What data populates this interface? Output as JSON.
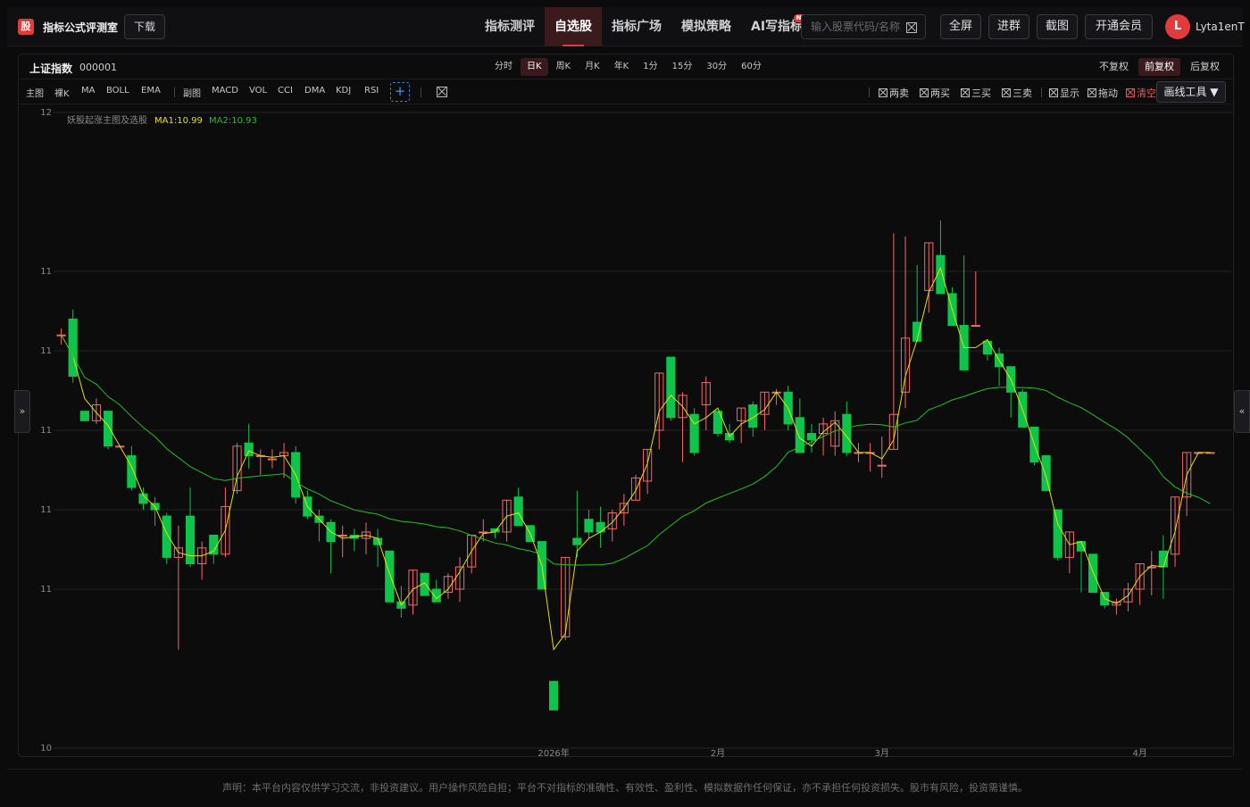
{
  "header": {
    "logo_char": "股",
    "brand": "指标公式评测室",
    "download": "下载",
    "nav": [
      {
        "label": "指标测评",
        "active": false
      },
      {
        "label": "自选股",
        "active": true
      },
      {
        "label": "指标广场",
        "active": false
      },
      {
        "label": "模拟策略",
        "active": false
      },
      {
        "label": "AI写指标",
        "active": false,
        "badge": "NEW"
      }
    ],
    "search_placeholder": "输入股票代码/名称",
    "buttons": {
      "fullscreen": "全屏",
      "join_group": "进群",
      "screenshot": "截图",
      "membership": "开通会员"
    },
    "user": {
      "avatar_letter": "L",
      "name": "Lyta1enT"
    }
  },
  "stock": {
    "name": "上证指数",
    "code": "000001"
  },
  "periods": [
    "分时",
    "日K",
    "周K",
    "月K",
    "年K",
    "1分",
    "15分",
    "30分",
    "60分"
  ],
  "active_period": "日K",
  "adjust": [
    "不复权",
    "前复权",
    "后复权"
  ],
  "active_adjust": "前复权",
  "indicators": {
    "main_label": "主图",
    "main": [
      "裸K",
      "MA",
      "BOLL",
      "EMA"
    ],
    "sub_label": "副图",
    "sub": [
      "MACD",
      "VOL",
      "CCI",
      "DMA",
      "KDJ",
      "RSI"
    ]
  },
  "tools": [
    "两卖",
    "两买",
    "三买",
    "三卖",
    "显示",
    "拖动",
    "清空"
  ],
  "draw_tools": "画线工具 ▼",
  "chart_data": {
    "type": "candlestick",
    "legend": {
      "formula": "妖股起涨主图及选股",
      "ma1": "MA1:10.99",
      "ma2": "MA2:10.93"
    },
    "y_ticks": [
      "12",
      "11",
      "11",
      "11",
      "11",
      "11",
      "10"
    ],
    "y_tick_values": [
      12,
      11.5,
      11.25,
      11,
      10.75,
      10.5,
      10
    ],
    "x_ticks": [
      "2026年",
      "2月",
      "3月",
      "4月"
    ],
    "ylim": [
      10,
      12
    ],
    "candles": [
      [
        11.3,
        11.32,
        11.27,
        11.3
      ],
      [
        11.35,
        11.38,
        11.15,
        11.17
      ],
      [
        11.06,
        11.06,
        11.03,
        11.03
      ],
      [
        11.03,
        11.1,
        11.02,
        11.08
      ],
      [
        11.06,
        11.06,
        10.94,
        10.95
      ],
      [
        10.95,
        10.95,
        10.95,
        10.95
      ],
      [
        10.92,
        10.95,
        10.81,
        10.82
      ],
      [
        10.8,
        10.82,
        10.75,
        10.77
      ],
      [
        10.77,
        10.79,
        10.7,
        10.75
      ],
      [
        10.73,
        10.74,
        10.58,
        10.6
      ],
      [
        10.6,
        10.7,
        10.31,
        10.63
      ],
      [
        10.73,
        10.82,
        10.57,
        10.58
      ],
      [
        10.58,
        10.65,
        10.53,
        10.63
      ],
      [
        10.67,
        10.67,
        10.58,
        10.61
      ],
      [
        10.61,
        10.82,
        10.6,
        10.76
      ],
      [
        10.81,
        10.96,
        10.8,
        10.95
      ],
      [
        10.96,
        11.02,
        10.88,
        10.92
      ],
      [
        10.92,
        10.94,
        10.86,
        10.92
      ],
      [
        10.91,
        10.94,
        10.88,
        10.91
      ],
      [
        10.92,
        10.96,
        10.85,
        10.93
      ],
      [
        10.93,
        10.95,
        10.77,
        10.79
      ],
      [
        10.79,
        10.81,
        10.72,
        10.73
      ],
      [
        10.73,
        10.75,
        10.65,
        10.71
      ],
      [
        10.71,
        10.72,
        10.55,
        10.65
      ],
      [
        10.67,
        10.7,
        10.6,
        10.67
      ],
      [
        10.67,
        10.69,
        10.62,
        10.66
      ],
      [
        10.66,
        10.71,
        10.61,
        10.68
      ],
      [
        10.66,
        10.69,
        10.57,
        10.64
      ],
      [
        10.62,
        10.62,
        10.49,
        10.46
      ],
      [
        10.46,
        10.51,
        10.41,
        10.44
      ],
      [
        10.45,
        10.55,
        10.42,
        10.56
      ],
      [
        10.55,
        10.54,
        10.48,
        10.48
      ],
      [
        10.5,
        10.53,
        10.46,
        10.46
      ],
      [
        10.49,
        10.55,
        10.47,
        10.54
      ],
      [
        10.5,
        10.6,
        10.46,
        10.57
      ],
      [
        10.57,
        10.67,
        10.55,
        10.67
      ],
      [
        10.68,
        10.72,
        10.65,
        10.68
      ],
      [
        10.69,
        10.69,
        10.66,
        10.68
      ],
      [
        10.68,
        10.73,
        10.65,
        10.78
      ],
      [
        10.79,
        10.82,
        10.71,
        10.7
      ],
      [
        10.7,
        10.7,
        10.65,
        10.65
      ],
      [
        10.65,
        10.55,
        10.5,
        10.5
      ],
      [
        10.21,
        10.2,
        10.12,
        10.12
      ],
      [
        10.35,
        10.6,
        10.34,
        10.6
      ],
      [
        10.66,
        10.81,
        10.6,
        10.64
      ],
      [
        10.72,
        10.75,
        10.66,
        10.68
      ],
      [
        10.71,
        10.76,
        10.63,
        10.68
      ],
      [
        10.69,
        10.75,
        10.65,
        10.74
      ],
      [
        10.74,
        10.8,
        10.7,
        10.77
      ],
      [
        10.78,
        10.86,
        10.78,
        10.85
      ],
      [
        10.84,
        10.91,
        10.8,
        10.94
      ],
      [
        11.0,
        11.17,
        10.94,
        11.18
      ],
      [
        11.23,
        11.23,
        11.03,
        11.04
      ],
      [
        11.04,
        11.12,
        10.9,
        11.11
      ],
      [
        11.05,
        11.07,
        10.92,
        10.93
      ],
      [
        11.08,
        11.17,
        11.0,
        11.15
      ],
      [
        11.06,
        11.06,
        10.98,
        10.99
      ],
      [
        10.99,
        11.02,
        10.96,
        10.97
      ],
      [
        11.03,
        11.06,
        10.96,
        11.07
      ],
      [
        11.08,
        11.09,
        10.98,
        11.01
      ],
      [
        11.05,
        11.09,
        11.0,
        11.12
      ],
      [
        11.12,
        11.13,
        11.08,
        11.12
      ],
      [
        11.12,
        11.14,
        11.0,
        11.02
      ],
      [
        11.04,
        11.1,
        10.96,
        10.93
      ],
      [
        10.99,
        11.02,
        10.93,
        10.97
      ],
      [
        10.99,
        11.04,
        10.92,
        11.02
      ],
      [
        10.95,
        11.06,
        10.92,
        11.03
      ],
      [
        11.05,
        11.09,
        10.92,
        10.93
      ],
      [
        10.93,
        10.96,
        10.9,
        10.93
      ],
      [
        10.93,
        10.96,
        10.87,
        10.93
      ],
      [
        10.89,
        10.98,
        10.85,
        10.89
      ],
      [
        10.94,
        11.62,
        10.94,
        11.05
      ],
      [
        11.12,
        11.61,
        11.07,
        11.29
      ],
      [
        11.34,
        11.52,
        11.35,
        11.28
      ],
      [
        11.44,
        11.51,
        11.37,
        11.59
      ],
      [
        11.55,
        11.66,
        11.47,
        11.43
      ],
      [
        11.43,
        11.45,
        11.43,
        11.33
      ],
      [
        11.33,
        11.55,
        11.24,
        11.19
      ],
      [
        11.33,
        11.5,
        11.34,
        11.33
      ],
      [
        11.28,
        11.27,
        11.22,
        11.24
      ],
      [
        11.24,
        11.26,
        11.14,
        11.2
      ],
      [
        11.2,
        11.18,
        11.04,
        11.12
      ],
      [
        11.12,
        11.13,
        11.01,
        11.01
      ],
      [
        11.01,
        11.0,
        10.89,
        10.9
      ],
      [
        10.92,
        10.92,
        10.81,
        10.81
      ],
      [
        10.75,
        10.73,
        10.59,
        10.6
      ],
      [
        10.6,
        10.62,
        10.55,
        10.68
      ],
      [
        10.65,
        10.64,
        10.49,
        10.62
      ],
      [
        10.61,
        10.58,
        10.49,
        10.49
      ],
      [
        10.49,
        10.47,
        10.44,
        10.45
      ],
      [
        10.45,
        10.47,
        10.42,
        10.46
      ],
      [
        10.46,
        10.52,
        10.43,
        10.5
      ],
      [
        10.5,
        10.58,
        10.45,
        10.58
      ],
      [
        10.57,
        10.62,
        10.48,
        10.57
      ],
      [
        10.62,
        10.67,
        10.47,
        10.57
      ],
      [
        10.61,
        10.71,
        10.57,
        10.79
      ],
      [
        10.79,
        10.92,
        10.73,
        10.93
      ],
      [
        10.93,
        10.93,
        10.93,
        10.93
      ],
      [
        10.93,
        10.93,
        10.93,
        10.93
      ]
    ],
    "ma1": "series-follow",
    "colors": {
      "up": "#f06a6a",
      "down": "#0ec44a",
      "ma1": "#e6e000",
      "ma2": "#1ec41e",
      "grid": "#222226"
    }
  },
  "footer": "声明：本平台内容仅供学习交流，非投资建议。用户操作风险自担；平台不对指标的准确性、有效性、盈利性、模拟数据作任何保证，亦不承担任何投资损失。股市有风险，投资需谨慎。"
}
